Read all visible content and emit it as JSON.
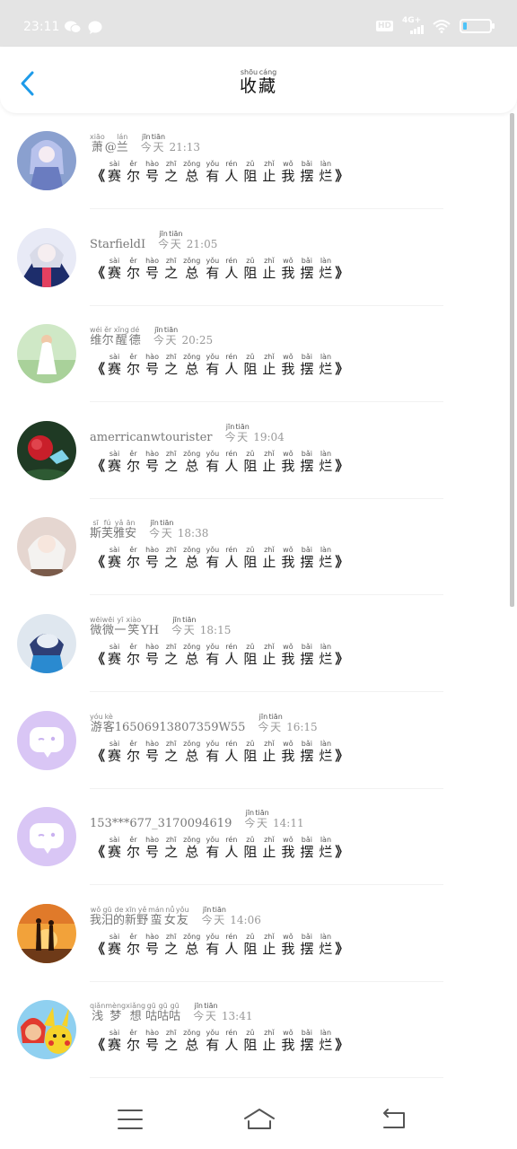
{
  "status_bar": {
    "time": "23:11",
    "left_icons": [
      "wechat-icon",
      "message-icon"
    ],
    "hd": "HD",
    "network": "4G+",
    "right_icons": [
      "signal-icon",
      "wifi-icon",
      "battery-icon"
    ]
  },
  "header": {
    "title_chars": [
      {
        "c": "收",
        "p": "shōu"
      },
      {
        "c": "藏",
        "p": "cáng"
      }
    ],
    "back_icon": "chevron-left-icon"
  },
  "colors": {
    "accent": "#1e9be9",
    "status_bar_bg": "#e4e4e4",
    "default_avatar_bg": "#d9c6f5"
  },
  "items_title": {
    "open": "《",
    "close": "》",
    "chars": [
      {
        "c": "赛",
        "p": "sài"
      },
      {
        "c": "尔",
        "p": "ěr"
      },
      {
        "c": "号",
        "p": "hào"
      },
      {
        "c": "之",
        "p": "zhī"
      },
      {
        "c": "总",
        "p": "zǒng"
      },
      {
        "c": "有",
        "p": "yǒu"
      },
      {
        "c": "人",
        "p": "rén"
      },
      {
        "c": "阻",
        "p": "zǔ"
      },
      {
        "c": "止",
        "p": "zhǐ"
      },
      {
        "c": "我",
        "p": "wǒ"
      },
      {
        "c": "摆",
        "p": "bǎi"
      },
      {
        "c": "烂",
        "p": "làn"
      }
    ]
  },
  "items": [
    {
      "user": [
        {
          "c": "萧",
          "p": "xiāo"
        },
        {
          "c": "@",
          "p": ""
        },
        {
          "c": "兰",
          "p": "lán"
        }
      ],
      "time_prefix": [
        {
          "c": "今",
          "p": "jīn"
        },
        {
          "c": "天",
          "p": "tiān"
        }
      ],
      "time": "21:13",
      "avatar": "anime-girl-blue"
    },
    {
      "user": [
        {
          "c": "StarfieldI",
          "p": ""
        }
      ],
      "time_prefix": [
        {
          "c": "今",
          "p": "jīn"
        },
        {
          "c": "天",
          "p": "tiān"
        }
      ],
      "time": "21:05",
      "avatar": "anime-girl-dark"
    },
    {
      "user": [
        {
          "c": "维",
          "p": "wéi"
        },
        {
          "c": "尔",
          "p": "ěr"
        },
        {
          "c": "醒",
          "p": "xǐng"
        },
        {
          "c": "德",
          "p": "dé"
        }
      ],
      "time_prefix": [
        {
          "c": "今",
          "p": "jīn"
        },
        {
          "c": "天",
          "p": "tiān"
        }
      ],
      "time": "20:25",
      "avatar": "girl-white-dress"
    },
    {
      "user": [
        {
          "c": "amerricanwtourister",
          "p": ""
        }
      ],
      "time_prefix": [
        {
          "c": "今",
          "p": "jīn"
        },
        {
          "c": "天",
          "p": "tiān"
        }
      ],
      "time": "19:04",
      "avatar": "red-flower-butterfly"
    },
    {
      "user": [
        {
          "c": "斯",
          "p": "sī"
        },
        {
          "c": "芙",
          "p": "fú"
        },
        {
          "c": "雅",
          "p": "yǎ"
        },
        {
          "c": "安",
          "p": "ān"
        }
      ],
      "time_prefix": [
        {
          "c": "今",
          "p": "jīn"
        },
        {
          "c": "天",
          "p": "tiān"
        }
      ],
      "time": "18:38",
      "avatar": "anime-girl-white-hair"
    },
    {
      "user": [
        {
          "c": "微",
          "p": "wēi"
        },
        {
          "c": "微",
          "p": "wēi"
        },
        {
          "c": "一",
          "p": "yī"
        },
        {
          "c": "笑",
          "p": "xiào"
        },
        {
          "c": "YH",
          "p": ""
        }
      ],
      "time_prefix": [
        {
          "c": "今",
          "p": "jīn"
        },
        {
          "c": "天",
          "p": "tiān"
        }
      ],
      "time": "18:15",
      "avatar": "robot-character"
    },
    {
      "user": [
        {
          "c": "游",
          "p": "yóu"
        },
        {
          "c": "客",
          "p": "kè"
        },
        {
          "c": "16506913807359W55",
          "p": ""
        }
      ],
      "time_prefix": [
        {
          "c": "今",
          "p": "jīn"
        },
        {
          "c": "天",
          "p": "tiān"
        }
      ],
      "time": "16:15",
      "avatar": "default-chat-bubble"
    },
    {
      "user": [
        {
          "c": "153***677_3170094619",
          "p": ""
        }
      ],
      "time_prefix": [
        {
          "c": "今",
          "p": "jīn"
        },
        {
          "c": "天",
          "p": "tiān"
        }
      ],
      "time": "14:11",
      "avatar": "default-chat-bubble"
    },
    {
      "user": [
        {
          "c": "我",
          "p": "wǒ"
        },
        {
          "c": "汨",
          "p": "gū"
        },
        {
          "c": "的",
          "p": "de"
        },
        {
          "c": "新",
          "p": "xīn"
        },
        {
          "c": "野",
          "p": "yě"
        },
        {
          "c": "蛮",
          "p": "mán"
        },
        {
          "c": "女",
          "p": "nǚ"
        },
        {
          "c": "友",
          "p": "yǒu"
        }
      ],
      "time_prefix": [
        {
          "c": "今",
          "p": "jīn"
        },
        {
          "c": "天",
          "p": "tiān"
        }
      ],
      "time": "14:06",
      "avatar": "couple-sunset"
    },
    {
      "user": [
        {
          "c": "浅",
          "p": "qiǎn"
        },
        {
          "c": "梦",
          "p": "mèng"
        },
        {
          "c": "想",
          "p": "xiǎng"
        },
        {
          "c": "咕",
          "p": "gū"
        },
        {
          "c": "咕",
          "p": "gū"
        },
        {
          "c": "咕",
          "p": "gū"
        }
      ],
      "time_prefix": [
        {
          "c": "今",
          "p": "jīn"
        },
        {
          "c": "天",
          "p": "tiān"
        }
      ],
      "time": "13:41",
      "avatar": "ash-pikachu"
    }
  ],
  "bottom_nav": {
    "icons": [
      "menu-icon",
      "home-icon",
      "back-icon"
    ]
  }
}
